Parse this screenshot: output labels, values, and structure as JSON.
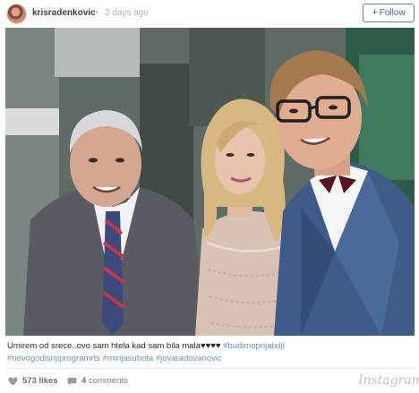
{
  "header": {
    "username": "krisradenkovic",
    "separator": "•",
    "timestamp": "2 days ago",
    "follow_label": "Follow",
    "follow_icon": "+"
  },
  "caption": {
    "text": "Umirem od srece..ovo sam htela kad sam bila mala",
    "hearts": "♥♥♥♥",
    "hashtags_line1": "#budimoprijatelji",
    "hashtags_line2": [
      "#novogodisnjiprogramrts",
      "#minjasubota",
      "#jovaradovanovic"
    ]
  },
  "footer": {
    "likes": "573 likes",
    "comments_count": "4",
    "comments_label": "comments",
    "brand": "Instagram"
  },
  "colors": {
    "follow_blue": "#3c6894",
    "hashtag": "#6d8fb0",
    "muted": "#7a7a7a"
  }
}
